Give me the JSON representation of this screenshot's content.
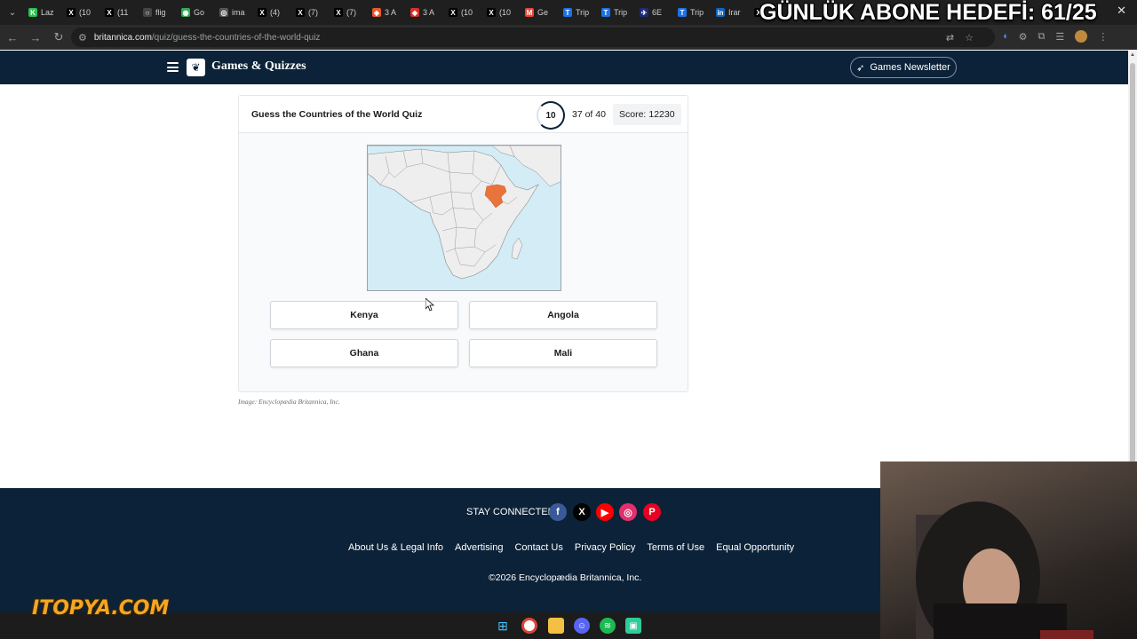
{
  "browser": {
    "tabs": [
      {
        "label": "Laz",
        "icon_color": "#27c24c",
        "glyph": "K"
      },
      {
        "label": "(10",
        "icon_color": "#000000",
        "glyph": "X"
      },
      {
        "label": "(11",
        "icon_color": "#000000",
        "glyph": "X"
      },
      {
        "label": "flig",
        "icon_color": "#444444",
        "glyph": "○"
      },
      {
        "label": "Go",
        "icon_color": "#34a853",
        "glyph": "◉"
      },
      {
        "label": "ima",
        "icon_color": "#555555",
        "glyph": "◎"
      },
      {
        "label": "(4)",
        "icon_color": "#000000",
        "glyph": "X"
      },
      {
        "label": "(7)",
        "icon_color": "#000000",
        "glyph": "X"
      },
      {
        "label": "(7)",
        "icon_color": "#000000",
        "glyph": "X"
      },
      {
        "label": "3 A",
        "icon_color": "#e8572e",
        "glyph": "◆"
      },
      {
        "label": "3 A",
        "icon_color": "#d93025",
        "glyph": "◆"
      },
      {
        "label": "(10",
        "icon_color": "#000000",
        "glyph": "X"
      },
      {
        "label": "(10",
        "icon_color": "#000000",
        "glyph": "X"
      },
      {
        "label": "Ge",
        "icon_color": "#ea4335",
        "glyph": "M"
      },
      {
        "label": "Trip",
        "icon_color": "#1a73e8",
        "glyph": "T"
      },
      {
        "label": "Trip",
        "icon_color": "#1a73e8",
        "glyph": "T"
      },
      {
        "label": "6E",
        "icon_color": "#1e2a78",
        "glyph": "✈"
      },
      {
        "label": "Trip",
        "icon_color": "#1a73e8",
        "glyph": "T"
      },
      {
        "label": "Irar",
        "icon_color": "#0a66c2",
        "glyph": "in"
      },
      {
        "label": "",
        "icon_color": "#000000",
        "glyph": "X"
      }
    ],
    "overlay_title": "GÜNLÜK ABONE HEDEFİ: 61/25",
    "url_host": "britannica.com",
    "url_path": "/quiz/guess-the-countries-of-the-world-quiz"
  },
  "header": {
    "brand": "Games & Quizzes",
    "newsletter_label": "Games Newsletter"
  },
  "quiz": {
    "title": "Guess the Countries of the World Quiz",
    "timer": "10",
    "progress": "37 of 40",
    "score_label": "Score:",
    "score_value": "12230",
    "highlight_color": "#e8743c",
    "answers": [
      "Kenya",
      "Angola",
      "Ghana",
      "Mali"
    ],
    "credit": "Image: Encyclopædia Britannica, Inc."
  },
  "footer": {
    "stay_connected": "STAY CONNECTED",
    "social": [
      {
        "name": "facebook-icon",
        "glyph": "f",
        "color": "#3b5998"
      },
      {
        "name": "x-icon",
        "glyph": "X",
        "color": "#000000"
      },
      {
        "name": "youtube-icon",
        "glyph": "▶",
        "color": "#ff0000"
      },
      {
        "name": "instagram-icon",
        "glyph": "◎",
        "color": "#e1306c"
      },
      {
        "name": "pinterest-icon",
        "glyph": "P",
        "color": "#e60023"
      }
    ],
    "links": [
      "About Us & Legal Info",
      "Advertising",
      "Contact Us",
      "Privacy Policy",
      "Terms of Use",
      "Equal Opportunity"
    ],
    "copyright": "©2026 Encyclopædia Britannica, Inc."
  },
  "overlay_logo": "ITOPYA.COM"
}
